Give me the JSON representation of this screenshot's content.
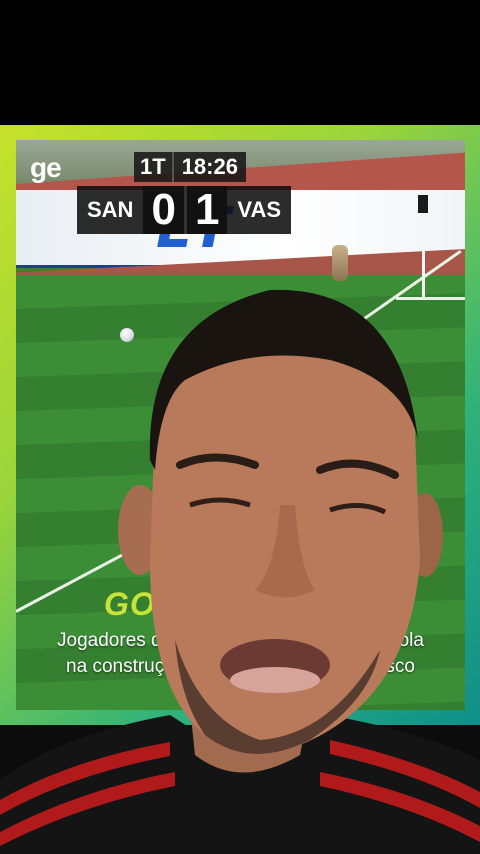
{
  "broadcast": {
    "brand": "ge",
    "ad_text": "ET",
    "period": "1T",
    "clock": "18:26",
    "home_team": "SAN",
    "home_score": "0",
    "away_score": "1",
    "away_team": "VAS"
  },
  "caption": {
    "label": "GO",
    "line1": "Jogadores do",
    "line1_end": "e bola",
    "line2": "na construçã",
    "line2_end": "asco"
  },
  "colors": {
    "frame_start": "#c6e12a",
    "frame_end": "#0f8f8a",
    "gol_label": "#c8e23a"
  }
}
